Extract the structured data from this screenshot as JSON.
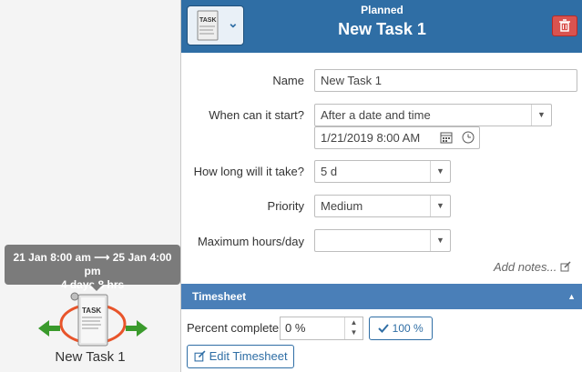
{
  "canvas": {
    "tooltip": {
      "date_range": "21 Jan 8:00 am ⟶ 25 Jan 4:00 pm",
      "duration": "4 days 8 hrs"
    },
    "node_label": "New Task 1",
    "node_icon_text": "TASK"
  },
  "header": {
    "status": "Planned",
    "title": "New Task 1",
    "type_icon_text": "TASK"
  },
  "form": {
    "name_label": "Name",
    "name_value": "New Task 1",
    "start_label": "When can it start?",
    "start_option": "After a date and time",
    "start_datetime": "1/21/2019 8:00 AM",
    "duration_label": "How long will it take?",
    "duration_value": "5 d",
    "priority_label": "Priority",
    "priority_value": "Medium",
    "max_hours_label": "Maximum hours/day",
    "max_hours_value": "",
    "add_notes": "Add notes..."
  },
  "timesheet": {
    "title": "Timesheet",
    "percent_label": "Percent complete",
    "percent_value": "0 %",
    "complete_button": "100 %",
    "edit_button": "Edit Timesheet"
  },
  "colors": {
    "header_blue": "#2f6ea5",
    "section_blue": "#4a7fb8",
    "delete_red": "#d9534f",
    "node_ring": "#e8542a",
    "node_arrows": "#3a9a2c",
    "tooltip_gray": "#7b7b7b"
  }
}
